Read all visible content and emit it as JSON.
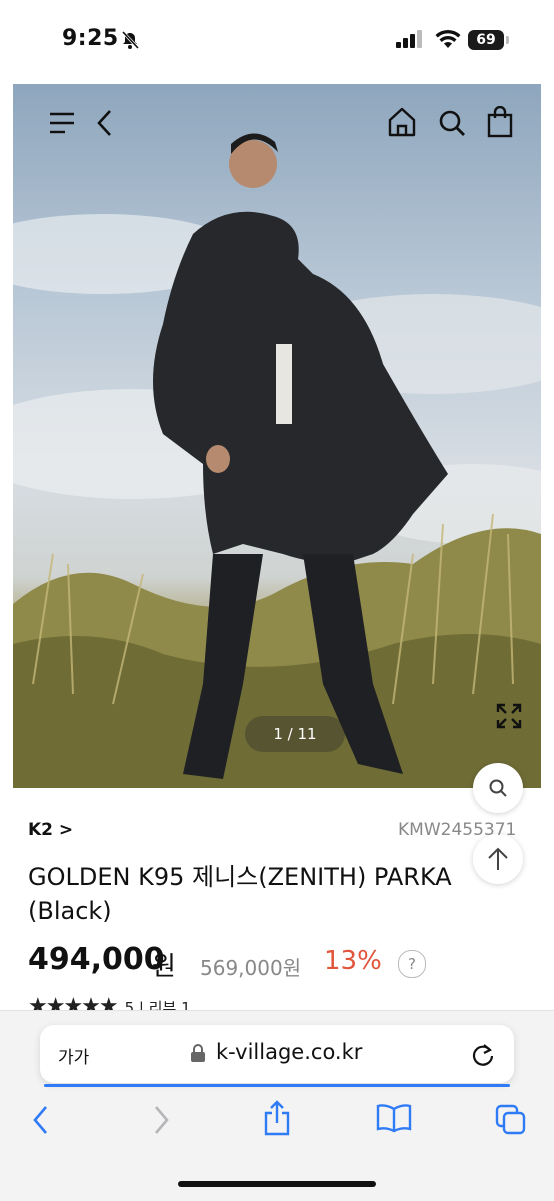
{
  "status_bar": {
    "time": "9:25",
    "battery": "69"
  },
  "header_icons": [
    "menu-icon",
    "back-icon",
    "home-icon",
    "search-icon",
    "shopping-bag-icon"
  ],
  "gallery": {
    "counter": "1 / 11"
  },
  "product": {
    "brand": "K2 >",
    "code": "KMW2455371",
    "title": "GOLDEN K95 제니스(ZENITH) PARKA (Black)",
    "price": "494,000",
    "currency": "원",
    "original_price": "569,000원",
    "discount": "13%",
    "help": "?",
    "rating_stars": "★★★★★",
    "rating_meta": "5 | 리뷰 1"
  },
  "browser": {
    "text_size_label": "가가",
    "url": "k-village.co.kr"
  },
  "colors": {
    "discount": "#e0553b",
    "accent": "#2f7bf6"
  }
}
